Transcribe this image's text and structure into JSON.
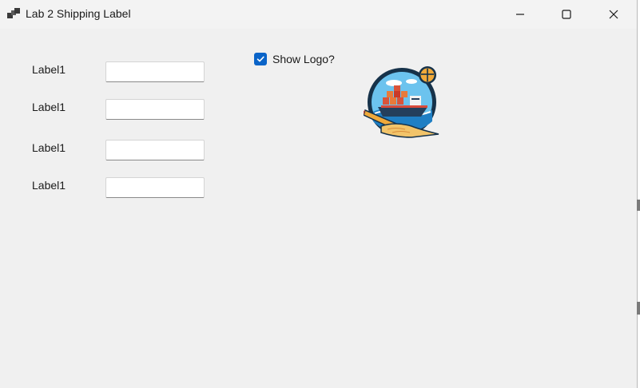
{
  "window": {
    "title": "Lab 2 Shipping Label",
    "icon": "app-window-icon",
    "controls": {
      "minimize_icon": "minimize-icon",
      "maximize_icon": "maximize-icon",
      "close_icon": "close-icon"
    }
  },
  "form": {
    "fields": [
      {
        "label": "Label1",
        "value": ""
      },
      {
        "label": "Label1",
        "value": ""
      },
      {
        "label": "Label1",
        "value": ""
      },
      {
        "label": "Label1",
        "value": ""
      }
    ],
    "show_logo": {
      "label": "Show Logo?",
      "checked": true
    },
    "logo_icon": "shipping-logo-icon"
  },
  "colors": {
    "checkbox_accent": "#0a64c8",
    "window_background": "#f0f0f0"
  }
}
